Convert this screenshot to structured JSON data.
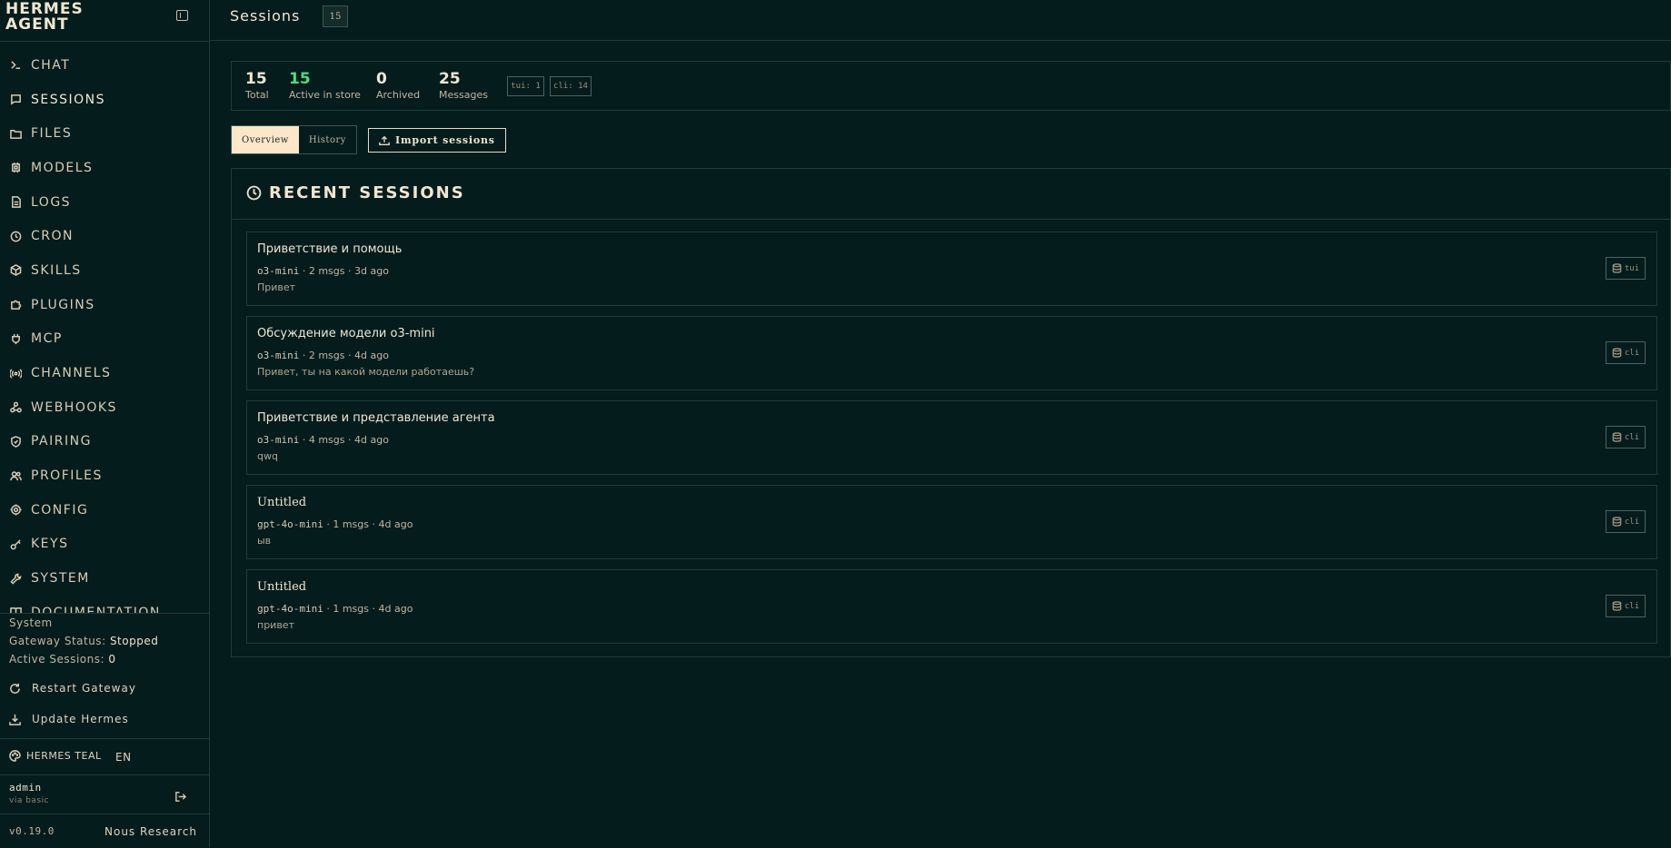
{
  "brand": {
    "name": "HERMES\nAGENT"
  },
  "nav": {
    "items": [
      {
        "label": "CHAT",
        "icon": "terminal-icon"
      },
      {
        "label": "SESSIONS",
        "icon": "message-square-icon"
      },
      {
        "label": "FILES",
        "icon": "folder-icon"
      },
      {
        "label": "MODELS",
        "icon": "cpu-icon"
      },
      {
        "label": "LOGS",
        "icon": "file-text-icon"
      },
      {
        "label": "CRON",
        "icon": "clock-icon"
      },
      {
        "label": "SKILLS",
        "icon": "package-icon"
      },
      {
        "label": "PLUGINS",
        "icon": "puzzle-icon"
      },
      {
        "label": "MCP",
        "icon": "plug-icon"
      },
      {
        "label": "CHANNELS",
        "icon": "radio-icon"
      },
      {
        "label": "WEBHOOKS",
        "icon": "webhook-icon"
      },
      {
        "label": "PAIRING",
        "icon": "shield-icon"
      },
      {
        "label": "PROFILES",
        "icon": "users-icon"
      },
      {
        "label": "CONFIG",
        "icon": "settings-icon"
      },
      {
        "label": "KEYS",
        "icon": "key-icon"
      },
      {
        "label": "SYSTEM",
        "icon": "wrench-icon"
      },
      {
        "label": "DOCUMENTATION",
        "icon": "book-icon"
      }
    ]
  },
  "system": {
    "heading": "System",
    "gateway_label": "Gateway Status:",
    "gateway_value": "Stopped",
    "active_label": "Active Sessions:",
    "active_value": "0",
    "restart_label": "Restart Gateway",
    "update_label": "Update Hermes"
  },
  "theme": {
    "name": "HERMES TEAL",
    "lang": "EN"
  },
  "user": {
    "name": "admin",
    "auth": "via basic"
  },
  "footer": {
    "version": "v0.19.0",
    "org": "Nous Research"
  },
  "header": {
    "title": "Sessions",
    "count": "15"
  },
  "stats": {
    "total": {
      "value": "15",
      "label": "Total"
    },
    "active": {
      "value": "15",
      "label": "Active in store"
    },
    "archived": {
      "value": "0",
      "label": "Archived"
    },
    "messages": {
      "value": "25",
      "label": "Messages"
    },
    "sources": [
      "tui: 1",
      "cli: 14"
    ]
  },
  "tabs": {
    "overview": "Overview",
    "history": "History"
  },
  "import_label": "Import sessions",
  "recent": {
    "title": "RECENT SESSIONS",
    "sessions": [
      {
        "title": "Приветствие и помощь",
        "model": "o3-mini",
        "meta": " · 2 msgs · 3d ago",
        "preview": "Привет",
        "source": "tui"
      },
      {
        "title": "Обсуждение модели o3-mini",
        "model": "o3-mini",
        "meta": " · 2 msgs · 4d ago",
        "preview": "Привет, ты на какой модели работаешь?",
        "source": "cli"
      },
      {
        "title": "Приветствие и представление агента",
        "model": "o3-mini",
        "meta": " · 4 msgs · 4d ago",
        "preview": "qwq",
        "source": "cli"
      },
      {
        "title": "Untitled",
        "model": "gpt-4o-mini",
        "meta": " · 1 msgs · 4d ago",
        "preview": "ыв",
        "source": "cli"
      },
      {
        "title": "Untitled",
        "model": "gpt-4o-mini",
        "meta": " · 1 msgs · 4d ago",
        "preview": "привет",
        "source": "cli"
      }
    ]
  },
  "colors": {
    "background": "#041c1c",
    "accent": "#fde7c8",
    "active_green": "#4ade80",
    "border": "#1f3d3a"
  }
}
